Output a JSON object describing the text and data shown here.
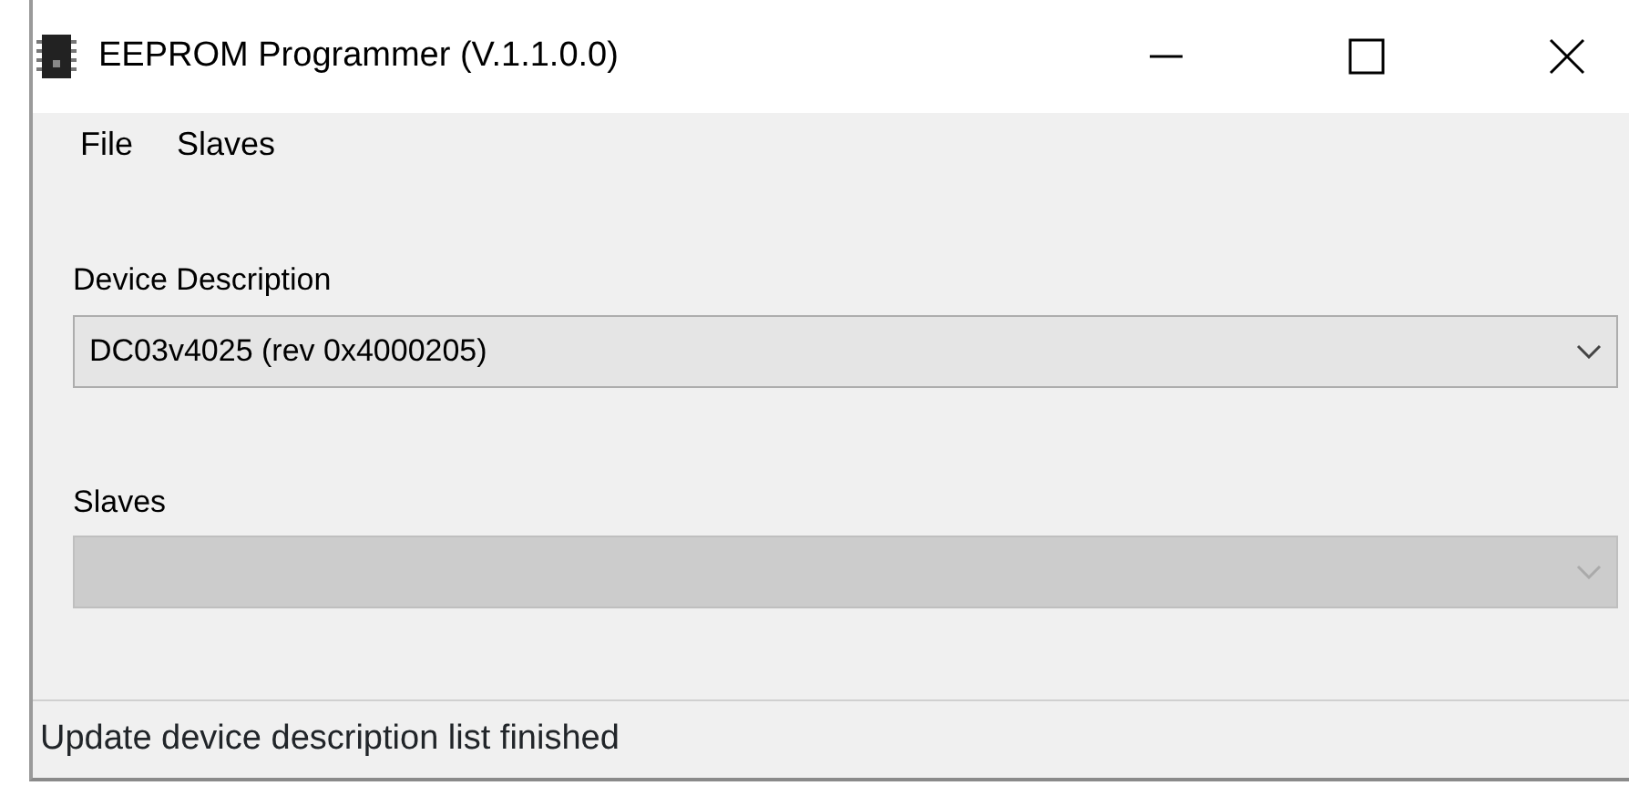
{
  "window": {
    "title": "EEPROM Programmer (V.1.1.0.0)"
  },
  "menu": [
    "File",
    "Slaves"
  ],
  "fields": [
    {
      "label": "Device Description",
      "value": "DC03v4025 (rev 0x4000205)",
      "disabled": false
    },
    {
      "label": "Slaves",
      "disabled": true
    }
  ],
  "status_bar": "Update device description list finished"
}
